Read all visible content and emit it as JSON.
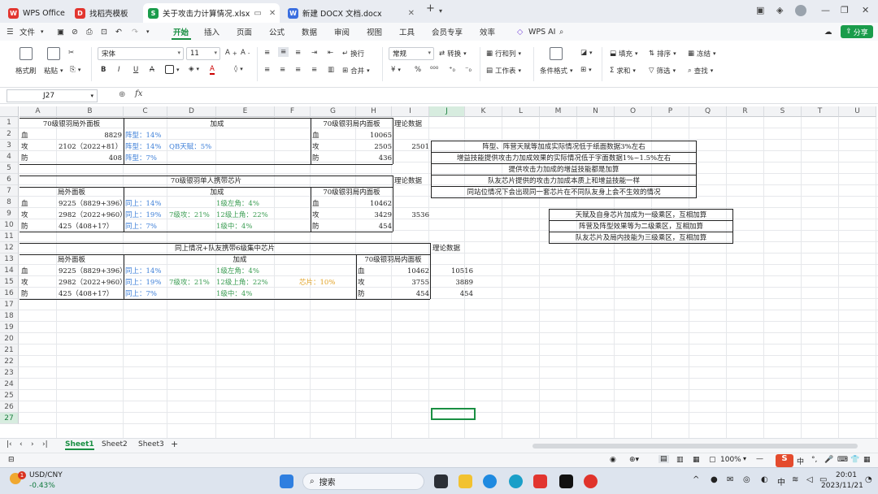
{
  "tabs": [
    {
      "name": "WPS Office",
      "logo": "W",
      "color": "#e2352f"
    },
    {
      "name": "找稻壳模板",
      "logo": "D",
      "color": "#e2352f"
    },
    {
      "name": "关于攻击力计算情况.xlsx",
      "logo": "S",
      "color": "#1a9c4b"
    },
    {
      "name": "新建 DOCX 文档.docx",
      "logo": "W",
      "color": "#3a6ee0"
    }
  ],
  "menu": {
    "file": "文件",
    "items": [
      "开始",
      "插入",
      "页面",
      "公式",
      "数据",
      "审阅",
      "视图",
      "工具",
      "会员专享",
      "效率"
    ],
    "ai": "WPS AI",
    "share": "分享"
  },
  "ribbon": {
    "format_painter": "格式刷",
    "paste": "粘贴",
    "font": "宋体",
    "size": "11",
    "wrap": "换行",
    "merge": "合并",
    "numfmt": "常规",
    "convert": "转换",
    "rowcol": "行和列",
    "worksheet": "工作表",
    "condfmt": "条件格式",
    "fill": "填充",
    "sort": "排序",
    "freeze": "冻结",
    "sum": "求和",
    "filter": "筛选",
    "find": "查找"
  },
  "formula": {
    "namebox": "J27",
    "fx": "fx"
  },
  "columns": [
    "A",
    "B",
    "C",
    "D",
    "E",
    "F",
    "G",
    "H",
    "I",
    "J",
    "K",
    "L",
    "M",
    "N",
    "O",
    "P",
    "Q",
    "R",
    "S",
    "T",
    "U"
  ],
  "rows": [
    "1",
    "2",
    "3",
    "4",
    "5",
    "6",
    "7",
    "8",
    "9",
    "10",
    "11",
    "12",
    "13",
    "14",
    "15",
    "16",
    "17",
    "18",
    "19",
    "20",
    "21",
    "22",
    "23",
    "24",
    "25",
    "26",
    "27"
  ],
  "cells": {
    "t1_title": "70级银羽局外面板",
    "t1_add": "加成",
    "t1_in": "70级银羽局内面板",
    "t1_theory": "理论数据",
    "hp": "血",
    "atk": "攻",
    "def": "防",
    "b2": "8829",
    "c2": "阵型：14%",
    "h2": "10065",
    "b3": "2102（2022+81）",
    "c3": "阵型：14%",
    "d3": "QB天赋：5%",
    "h3": "2505",
    "i3": "2501",
    "b4": "408",
    "c4": "阵型：7%",
    "h4": "436",
    "sec6": "70级银羽单人携带芯片",
    "sec6_theory": "理论数据",
    "r7_a": "局外面板",
    "r7_add": "加成",
    "r7_in": "70级银羽局内面板",
    "b8": "9225（8829+396）",
    "c8": "同上：14%",
    "e8": "1级左角：4%",
    "h8": "10462",
    "b9": "2982（2022+960）",
    "c9": "同上：19%",
    "d9": "7级攻：21%",
    "e9": "12级上角：22%",
    "h9": "3429",
    "i9": "3536",
    "b10": "425（408+17）",
    "c10": "同上：7%",
    "e10": "1级中：4%",
    "h10": "454",
    "sec12": "同上情况+队友携带6级集中芯片",
    "sec12_theory": "理论数据",
    "r13_a": "局外面板",
    "r13_add": "加成",
    "r13_in": "70级银羽局内面板",
    "b14": "9225（8829+396）",
    "c14": "同上：14%",
    "e14": "1级左角：4%",
    "h14": "10462",
    "j14": "10516",
    "b15": "2982（2022+960）",
    "c15": "同上：19%",
    "d15": "7级攻：21%",
    "e15": "12级上角：22%",
    "f15": "芯片：10%",
    "h15": "3755",
    "j15": "3889",
    "b16": "425（408+17）",
    "c16": "同上：7%",
    "e16": "1级中：4%",
    "h16": "454",
    "j16": "454",
    "notes1": [
      "阵型、阵营天赋等加成实际情况低于纸面数据3%左右",
      "增益技能提供攻击力加成效果的实际情况低于字面数据1%~1.5%左右",
      "提供攻击力加成的增益技能都是加算",
      "队友芯片提供的攻击力加成本质上和增益技能一样",
      "同站位情况下会出现同一套芯片在不同队友身上会不生效的情况"
    ],
    "notes2": [
      "天赋及自身芯片加成为一级乘区，互相加算",
      "阵营及阵型效果等为二级乘区，互相加算",
      "队友芯片及局内技能为三级乘区，互相加算"
    ]
  },
  "sheets": [
    "Sheet1",
    "Sheet2",
    "Sheet3"
  ],
  "status": {
    "zoom": "100%"
  },
  "taskbar": {
    "ticker": "USD/CNY",
    "change": "-0.43%",
    "search": "搜索",
    "lang": "中",
    "time": "20:01",
    "date": "2023/11/21",
    "badge": "1"
  }
}
